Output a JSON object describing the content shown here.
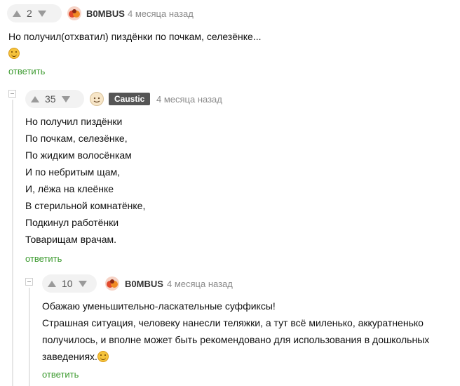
{
  "comments": [
    {
      "votes": "2",
      "author": "B0MBUS",
      "time": "4 месяца назад",
      "lines": [
        "Но получил(отхватил) пиздёнки по почкам, селезёнке..."
      ],
      "emoji": "smile-emoji",
      "reply": "ответить"
    },
    {
      "votes": "35",
      "author": "Caustic",
      "time": "4 месяца назад",
      "lines": [
        "Но получил пиздёнки",
        "По почкам, селезёнке,",
        "По жидким волосёнкам",
        "И по небритым щам,",
        "И, лёжа на клеёнке",
        "В стерильной комнатёнке,",
        "Подкинул работёнки",
        "Товарищам врачам."
      ],
      "reply": "ответить"
    },
    {
      "votes": "10",
      "author": "B0MBUS",
      "time": "4 месяца назад",
      "lines": [
        "Обажаю уменьшительно-ласкательные суффиксы!",
        "Страшная ситуация, человеку нанесли теляжки, а тут всё миленько, аккуратненько",
        "получилось, и вполне может быть рекомендовано для использования в дошкольных",
        "заведениях."
      ],
      "emoji": "smile-emoji",
      "reply": "ответить"
    }
  ],
  "colors": {
    "reply": "#3b9a2e",
    "badge": "#555555",
    "vote_bg": "#f2f2f2"
  }
}
